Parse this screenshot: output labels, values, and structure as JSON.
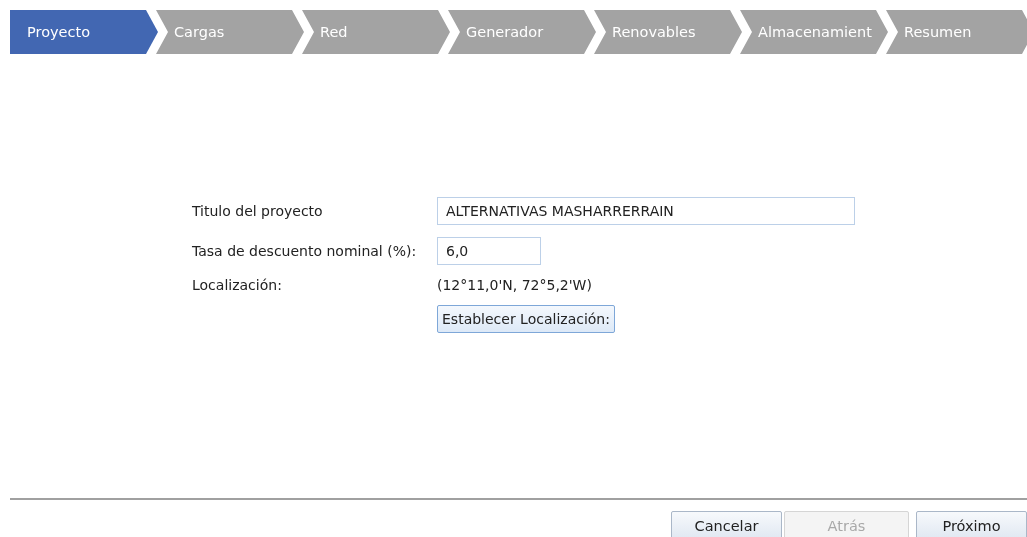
{
  "steps": [
    {
      "label": "Proyecto",
      "selected": true
    },
    {
      "label": "Cargas",
      "selected": false
    },
    {
      "label": "Red",
      "selected": false
    },
    {
      "label": "Generador",
      "selected": false
    },
    {
      "label": "Renovables",
      "selected": false
    },
    {
      "label": "Almacenamient",
      "selected": false
    },
    {
      "label": "Resumen",
      "selected": false
    }
  ],
  "form": {
    "fields": [
      {
        "kind": "input",
        "label": "Titulo del proyecto",
        "value": "ALTERNATIVAS MASHARRERRAIN",
        "wide": true
      },
      {
        "kind": "input",
        "label": "Tasa de descuento nominal (%):",
        "value": "6,0",
        "wide": false
      },
      {
        "kind": "text",
        "label": "Localización:",
        "value": "(12°11,0'N, 72°5,2'W)"
      },
      {
        "kind": "button",
        "label": "Establecer Localización:"
      }
    ]
  },
  "buttons": [
    {
      "label": "Cancelar",
      "disabled": false
    },
    {
      "label": "Atrás",
      "disabled": true
    },
    {
      "label": "Próximo",
      "disabled": false
    }
  ]
}
